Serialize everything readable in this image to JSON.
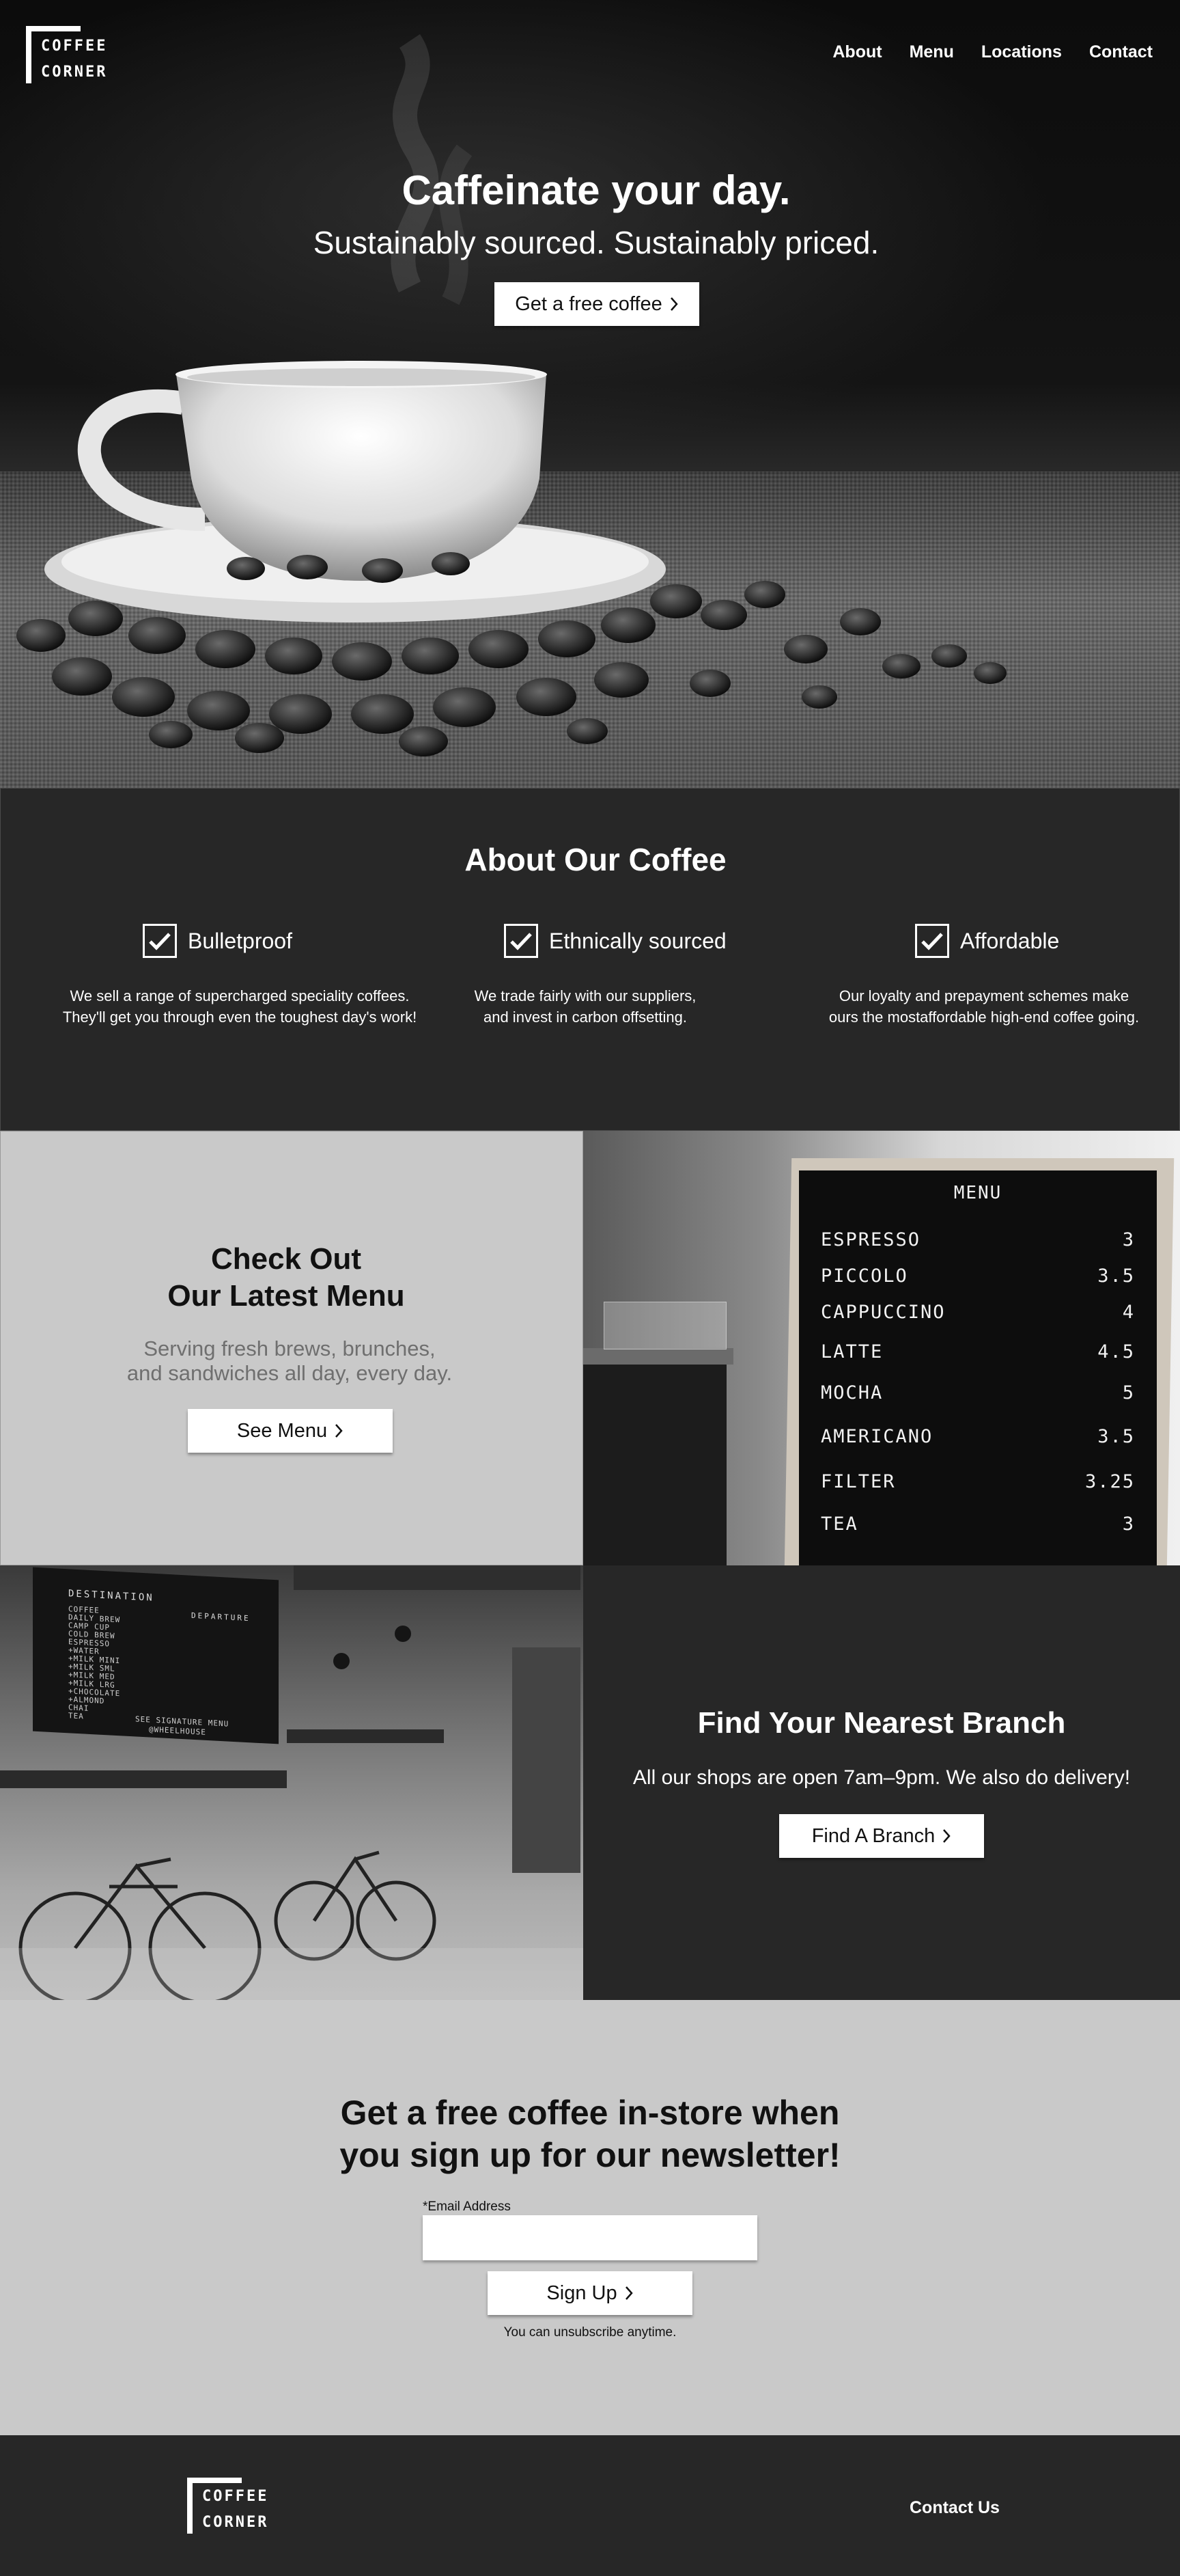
{
  "brand": {
    "line1": "COFFEE",
    "line2": "CORNER"
  },
  "nav": {
    "items": [
      {
        "label": "About"
      },
      {
        "label": "Menu"
      },
      {
        "label": "Locations"
      },
      {
        "label": "Contact"
      }
    ]
  },
  "hero": {
    "title": "Caffeinate your day.",
    "subtitle": "Sustainably sourced. Sustainably priced.",
    "cta_label": "Get a free coffee"
  },
  "about": {
    "title": "About Our Coffee",
    "features": [
      {
        "title": "Bulletproof",
        "desc_line1": "We sell a range of  supercharged speciality coffees.",
        "desc_line2": "They'll get you  through even the toughest day's work!",
        "checked": true
      },
      {
        "title": "Ethnically sourced",
        "desc_line1": "We trade fairly with our suppliers,",
        "desc_line2": "and invest in carbon offsetting.",
        "checked": true
      },
      {
        "title": "Affordable",
        "desc_line1": "Our loyalty and prepayment schemes make",
        "desc_line2": "ours the mostaffordable  high-end coffee going.",
        "checked": true
      }
    ]
  },
  "menu_promo": {
    "title_line1": "Check Out",
    "title_line2": "Our Latest Menu",
    "sub_line1": "Serving fresh brews, brunches,",
    "sub_line2": "and sandwiches all day, every day.",
    "button_label": "See Menu"
  },
  "menu_board": {
    "heading": "MENU",
    "items": [
      {
        "name": "ESPRESSO",
        "price": "3"
      },
      {
        "name": "PICCOLO",
        "price": "3.5"
      },
      {
        "name": "CAPPUCCINO",
        "price": "4"
      },
      {
        "name": "LATTE",
        "price": "4.5"
      },
      {
        "name": "MOCHA",
        "price": "5"
      },
      {
        "name": "AMERICANO",
        "price": "3.5"
      },
      {
        "name": "FILTER",
        "price": "3.25"
      },
      {
        "name": "TEA",
        "price": "3"
      }
    ]
  },
  "cafe_board": {
    "left_heading": "DESTINATION",
    "right_heading": "DEPARTURE",
    "lines": [
      "COFFEE",
      "DAILY BREW",
      "CAMP CUP",
      "COLD BREW",
      "ESPRESSO",
      "+WATER",
      "+MILK MINI",
      "+MILK SML",
      "+MILK MED",
      "+MILK LRG",
      "+CHOCOLATE",
      "+ALMOND",
      "CHAI",
      "TEA"
    ],
    "footer_line1": "SEE SIGNATURE MENU",
    "footer_line2": "@WHEELHOUSE"
  },
  "branch": {
    "title": "Find Your Nearest Branch",
    "subtitle": "All our shops are open 7am–9pm. We also do delivery!",
    "button_label": "Find A Branch"
  },
  "newsletter": {
    "title_line1": "Get a free coffee in-store when",
    "title_line2": "you sign up for our newsletter!",
    "email_label": "*Email Address",
    "email_value": "",
    "email_placeholder": "",
    "button_label": "Sign Up",
    "note": "You can unsubscribe anytime."
  },
  "footer": {
    "contact_label": "Contact Us"
  },
  "colors": {
    "dark": "#272727",
    "light": "#c9c9c9",
    "white": "#ffffff",
    "muted": "#6f6f6f"
  }
}
